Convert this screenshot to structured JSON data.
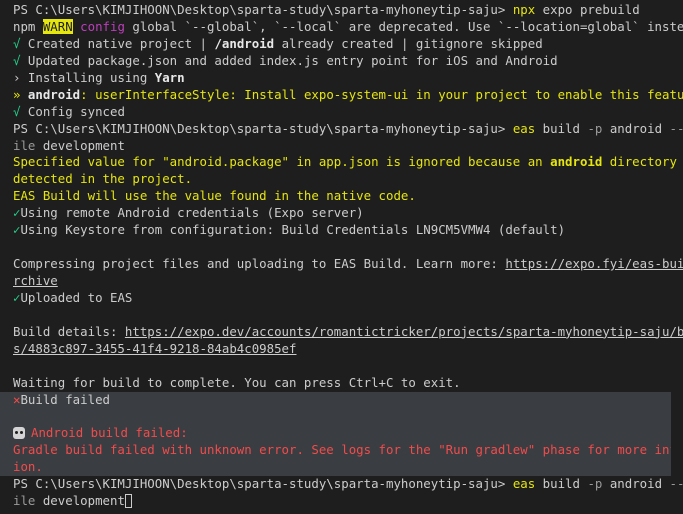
{
  "prompt": "PS C:\\Users\\KIMJIHOON\\Desktop\\sparta-study\\sparta-myhoneytip-saju>",
  "cmd1": {
    "bin": "npx",
    "args": " expo prebuild"
  },
  "warn": {
    "npm": "npm ",
    "badge": "WARN",
    "config": " config",
    "text": " global `--global`, `--local` are deprecated. Use `--location=global` instead."
  },
  "l_created": {
    "icon": "√",
    "pre": " Created native project | ",
    "bold": "/android",
    "post": " already created | gitignore skipped"
  },
  "l_updated": {
    "icon": "√",
    "text": " Updated package.json and added index.js entry point for iOS and Android"
  },
  "l_install": {
    "icon": "›",
    "pre": " Installing using ",
    "bold": "Yarn"
  },
  "l_android": {
    "icon": "»",
    "bold": " android",
    "text": ": userInterfaceStyle: Install expo-system-ui in your project to enable this feature."
  },
  "l_synced": {
    "icon": "√",
    "text": " Config synced"
  },
  "cmd2": {
    "bin": "eas",
    "sub": " build ",
    "flag1": "-p",
    "arg1": " android ",
    "flag2a": "--prof",
    "flag2b": "ile",
    "arg2": " development"
  },
  "spec": {
    "pre": "Specified value for \"android.package\" in app.json is ignored because an ",
    "bold": "android",
    "post": " directory was",
    "line2": "detected in the project.",
    "line3": "EAS Build will use the value found in the native code."
  },
  "creds": {
    "icon": "✓",
    "text": "Using remote Android credentials (Expo server)"
  },
  "keystore": {
    "icon": "✓",
    "text": "Using Keystore from configuration: Build Credentials LN9CM5VMW4 (default)"
  },
  "compress": {
    "text": "Compressing project files and uploading to EAS Build. Learn more: ",
    "link_a": "https://expo.fyi/eas-build-a",
    "link_b": "rchive"
  },
  "uploaded": {
    "icon": "✓",
    "text": "Uploaded to EAS"
  },
  "details": {
    "label": "Build details: ",
    "link_a": "https://expo.dev/accounts/romantictricker/projects/sparta-myhoneytip-saju/build",
    "link_b": "s/4883c897-3455-41f4-9218-84ab4c0985ef"
  },
  "waiting": "Waiting for build to complete. You can press Ctrl+C to exit.",
  "failed": {
    "icon": "✕",
    "text": "Build failed"
  },
  "android_failed": "Android build failed:",
  "gradle": {
    "line1": "Gradle build failed with unknown error. See logs for the \"Run gradlew\" phase for more informat",
    "line2": "ion."
  },
  "cmd3": {
    "bin": "eas",
    "sub": " build ",
    "flag1": "-p",
    "arg1": " android ",
    "flag2a": "--prof",
    "flag2b": "ile",
    "arg2": " development"
  }
}
